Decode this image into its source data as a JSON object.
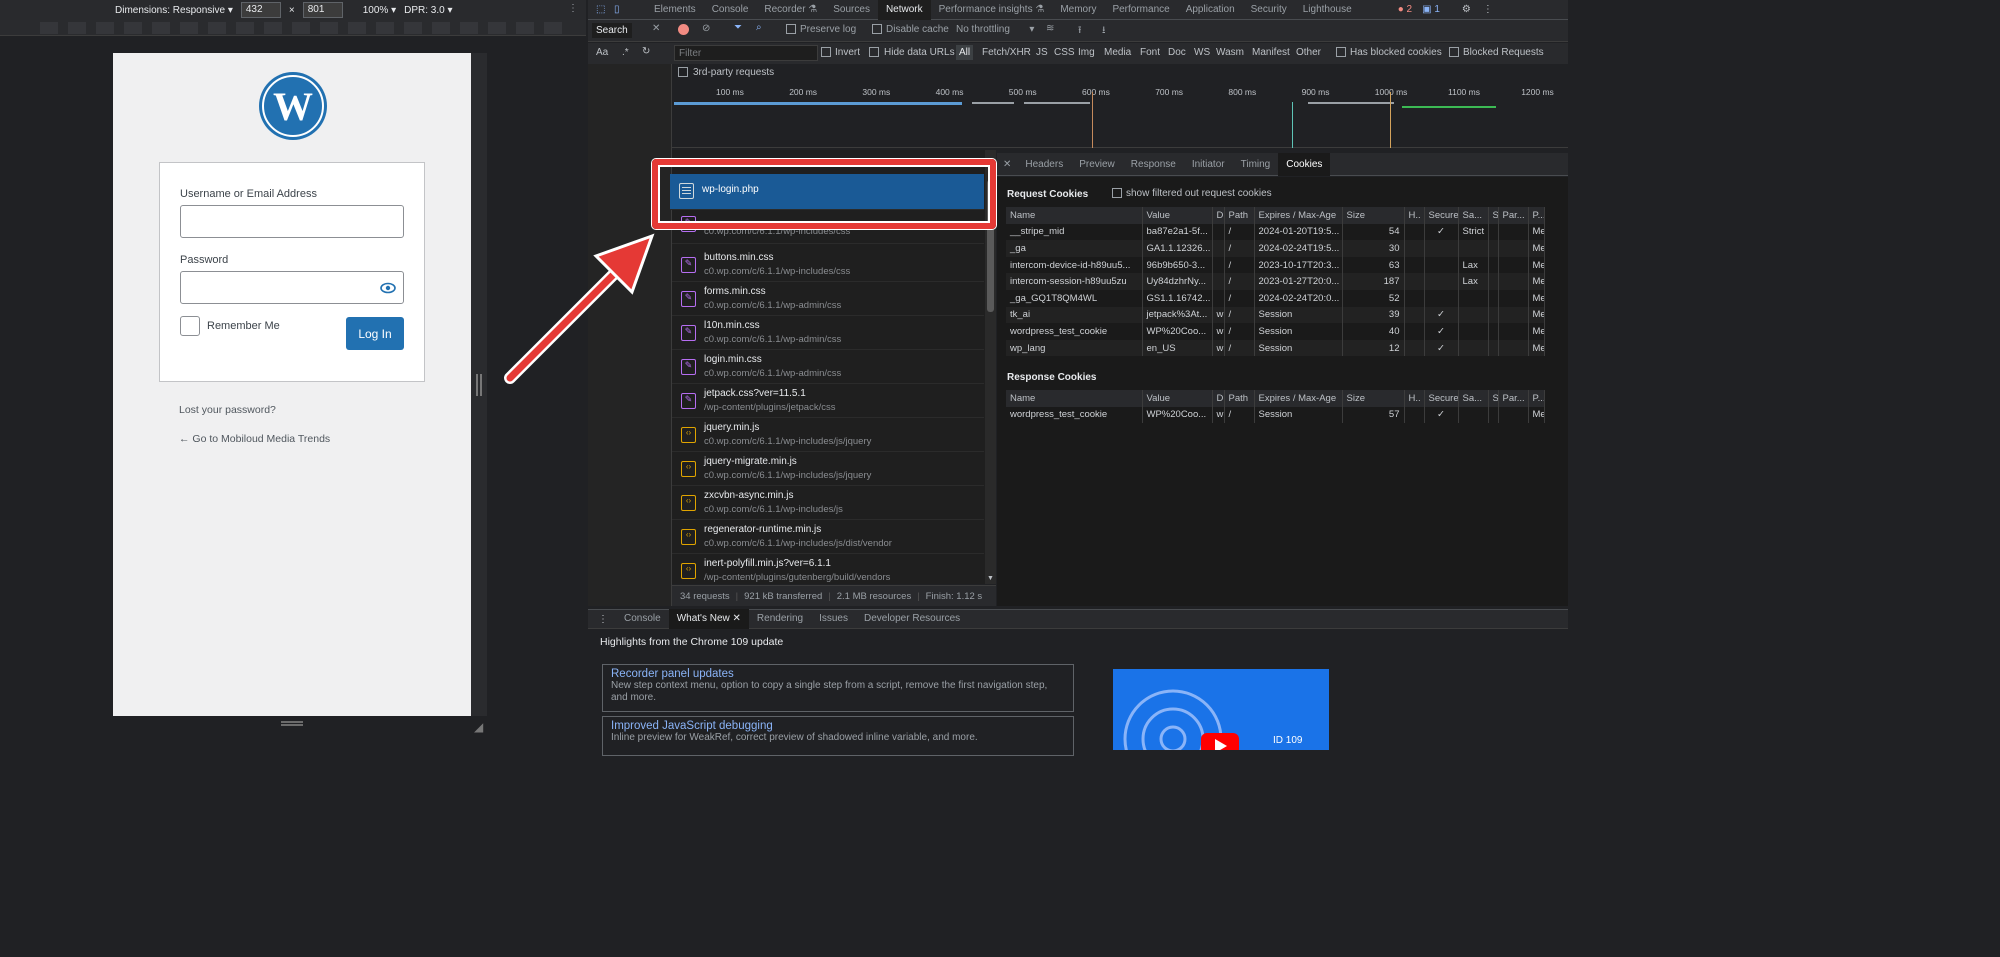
{
  "device_toolbar": {
    "dimensions_label": "Dimensions: Responsive",
    "width_value": "432",
    "times": "×",
    "height_value": "801",
    "zoom": "100%",
    "dpr": "DPR: 3.0"
  },
  "login_page": {
    "username_label": "Username or Email Address",
    "password_label": "Password",
    "remember_label": "Remember Me",
    "login_button": "Log In",
    "lost_password": "Lost your password?",
    "back_link": "← Go to Mobiloud Media Trends"
  },
  "devtools": {
    "tabs": [
      "Elements",
      "Console",
      "Recorder ⚗",
      "Sources",
      "Network",
      "Performance insights ⚗",
      "Memory",
      "Performance",
      "Application",
      "Security",
      "Lighthouse"
    ],
    "active_tab": "Network",
    "error_count": "2",
    "message_count": "1",
    "network_toolbar": {
      "search_label": "Search",
      "preserve_log": "Preserve log",
      "disable_cache": "Disable cache",
      "throttling": "No throttling"
    },
    "filter_bar": {
      "filter_placeholder": "Filter",
      "invert": "Invert",
      "hide_data_urls": "Hide data URLs",
      "types": [
        "All",
        "Fetch/XHR",
        "JS",
        "CSS",
        "Img",
        "Media",
        "Font",
        "Doc",
        "WS",
        "Wasm",
        "Manifest",
        "Other"
      ],
      "has_blocked_cookies": "Has blocked cookies",
      "blocked_requests": "Blocked Requests",
      "third_party": "3rd-party requests"
    },
    "timeline_ticks": [
      "100 ms",
      "200 ms",
      "300 ms",
      "400 ms",
      "500 ms",
      "600 ms",
      "700 ms",
      "800 ms",
      "900 ms",
      "1000 ms",
      "1100 ms",
      "1200 ms"
    ],
    "requests": [
      {
        "name": "wp-login.php",
        "sub": "",
        "type": "doc"
      },
      {
        "name": "",
        "sub": "c0.wp.com/c/6.1.1/wp-includes/css",
        "type": "css"
      },
      {
        "name": "buttons.min.css",
        "sub": "c0.wp.com/c/6.1.1/wp-includes/css",
        "type": "css"
      },
      {
        "name": "forms.min.css",
        "sub": "c0.wp.com/c/6.1.1/wp-admin/css",
        "type": "css"
      },
      {
        "name": "l10n.min.css",
        "sub": "c0.wp.com/c/6.1.1/wp-admin/css",
        "type": "css"
      },
      {
        "name": "login.min.css",
        "sub": "c0.wp.com/c/6.1.1/wp-admin/css",
        "type": "css"
      },
      {
        "name": "jetpack.css?ver=11.5.1",
        "sub": "/wp-content/plugins/jetpack/css",
        "type": "css"
      },
      {
        "name": "jquery.min.js",
        "sub": "c0.wp.com/c/6.1.1/wp-includes/js/jquery",
        "type": "js"
      },
      {
        "name": "jquery-migrate.min.js",
        "sub": "c0.wp.com/c/6.1.1/wp-includes/js/jquery",
        "type": "js"
      },
      {
        "name": "zxcvbn-async.min.js",
        "sub": "c0.wp.com/c/6.1.1/wp-includes/js",
        "type": "js"
      },
      {
        "name": "regenerator-runtime.min.js",
        "sub": "c0.wp.com/c/6.1.1/wp-includes/js/dist/vendor",
        "type": "js"
      },
      {
        "name": "inert-polyfill.min.js?ver=6.1.1",
        "sub": "/wp-content/plugins/gutenberg/build/vendors",
        "type": "js"
      }
    ],
    "status": {
      "requests": "34 requests",
      "transferred": "921 kB transferred",
      "resources": "2.1 MB resources",
      "finish": "Finish: 1.12 s"
    },
    "detail_tabs": [
      "Headers",
      "Preview",
      "Response",
      "Initiator",
      "Timing",
      "Cookies"
    ],
    "detail_active": "Cookies",
    "request_cookies_title": "Request Cookies",
    "show_filtered": "show filtered out request cookies",
    "columns": [
      "Name",
      "Value",
      "D",
      "Path",
      "Expires / Max-Age",
      "Size",
      "H..",
      "Secure",
      "Sa...",
      "S.",
      "Par...",
      "P..."
    ],
    "request_cookies": [
      [
        "__stripe_mid",
        "ba87e2a1-5f...",
        "",
        "/",
        "2024-01-20T19:5...",
        "54",
        "",
        "✓",
        "Strict",
        "",
        "",
        "Me..."
      ],
      [
        "_ga",
        "GA1.1.12326...",
        "",
        "/",
        "2024-02-24T19:5...",
        "30",
        "",
        "",
        "",
        "",
        "",
        "Me..."
      ],
      [
        "intercom-device-id-h89uu5...",
        "96b9b650-3...",
        "",
        "/",
        "2023-10-17T20:3...",
        "63",
        "",
        "",
        "Lax",
        "",
        "",
        "Me..."
      ],
      [
        "intercom-session-h89uu5zu",
        "Uy84dzhrNy...",
        "",
        "/",
        "2023-01-27T20:0...",
        "187",
        "",
        "",
        "Lax",
        "",
        "",
        "Me..."
      ],
      [
        "_ga_GQ1T8QM4WL",
        "GS1.1.16742...",
        "",
        "/",
        "2024-02-24T20:0...",
        "52",
        "",
        "",
        "",
        "",
        "",
        "Me..."
      ],
      [
        "tk_ai",
        "jetpack%3At...",
        "w",
        "/",
        "Session",
        "39",
        "",
        "✓",
        "",
        "",
        "",
        "Me..."
      ],
      [
        "wordpress_test_cookie",
        "WP%20Coo...",
        "w",
        "/",
        "Session",
        "40",
        "",
        "✓",
        "",
        "",
        "",
        "Me..."
      ],
      [
        "wp_lang",
        "en_US",
        "w",
        "/",
        "Session",
        "12",
        "",
        "✓",
        "",
        "",
        "",
        "Me..."
      ]
    ],
    "response_cookies_title": "Response Cookies",
    "response_cookies": [
      [
        "wordpress_test_cookie",
        "WP%20Coo...",
        "w",
        "/",
        "Session",
        "57",
        "",
        "✓",
        "",
        "",
        "",
        "Me..."
      ]
    ],
    "drawer_tabs": [
      "Console",
      "What's New",
      "Rendering",
      "Issues",
      "Developer Resources"
    ],
    "drawer_active": "What's New",
    "highlights": "Highlights from the Chrome 109 update",
    "cards": [
      {
        "title": "Recorder panel updates",
        "desc": "New step context menu, option to copy a single step from a script, remove the first navigation step, and more."
      },
      {
        "title": "Improved JavaScript debugging",
        "desc": "Inline preview for WeakRef, correct preview of shadowed inline variable, and more."
      }
    ],
    "video_caption": "ID 109"
  },
  "colors": {
    "highlight_red": "#e53935",
    "wp_blue": "#2271b1",
    "selected_row": "#1a5a96"
  }
}
